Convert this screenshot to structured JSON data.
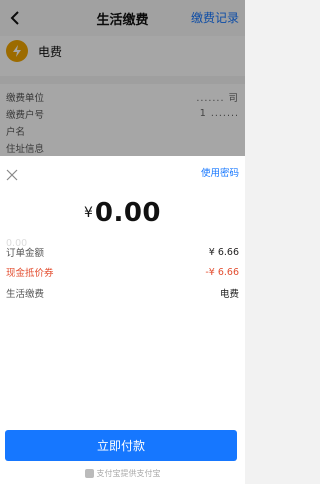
{
  "nav": {
    "title": "生活缴费",
    "record_label": "缴费记录"
  },
  "biz": {
    "icon": "lightning-icon",
    "name": "电费"
  },
  "info": {
    "rows": [
      {
        "label": "缴费单位",
        "value": "....... 司"
      },
      {
        "label": "缴费户号",
        "value": "1 ......."
      },
      {
        "label": "户名",
        "value": ""
      },
      {
        "label": "住址信息",
        "value": ""
      }
    ]
  },
  "sheet": {
    "use_password": "使用密码",
    "currency": "¥",
    "amount": "0.00",
    "order_label": "订单金额",
    "order_value": "¥ 6.66",
    "coupon_label": "现金抵价券",
    "coupon_value": "-¥ 6.66",
    "service_label": "生活缴费",
    "service_value": "电费",
    "faint_text": "0.00",
    "pay_button": "立即付款",
    "footer": "支付宝提供支付宝",
    "accent_color": "#1677ff",
    "discount_color": "#e34d2f"
  }
}
